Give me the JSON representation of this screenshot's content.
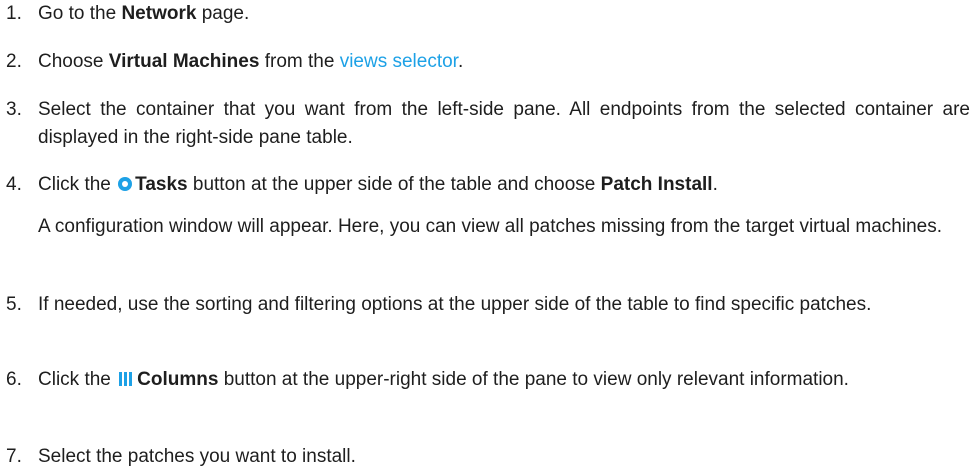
{
  "steps": [
    {
      "num": "1.",
      "a": "Go to the ",
      "b": "Network",
      "c": " page."
    },
    {
      "num": "2.",
      "a": "Choose ",
      "b": "Virtual Machines",
      "c": " from the ",
      "link": "views selector",
      "d": "."
    },
    {
      "num": "3.",
      "text": "Select the container that you want from the left-side pane. All endpoints from the selected container are displayed in the right-side pane table."
    },
    {
      "num": "4.",
      "a": "Click the ",
      "icon": "tasks-icon",
      "b": "Tasks",
      "c": " button at the upper side of the table and choose ",
      "d": "Patch Install",
      "e": ".",
      "note": "A configuration window will appear. Here, you can view all patches missing from the target virtual machines."
    },
    {
      "num": "5.",
      "text": "If needed, use the sorting and filtering options at the upper side of the table to find specific patches."
    },
    {
      "num": "6.",
      "a": "Click the ",
      "icon": "columns-icon",
      "b": "Columns",
      "c": " button at the upper-right side of the pane to view only relevant information."
    },
    {
      "num": "7.",
      "text": "Select the patches you want to install."
    }
  ],
  "colors": {
    "text": "#1e1e1e",
    "accent": "#1da1e6"
  }
}
